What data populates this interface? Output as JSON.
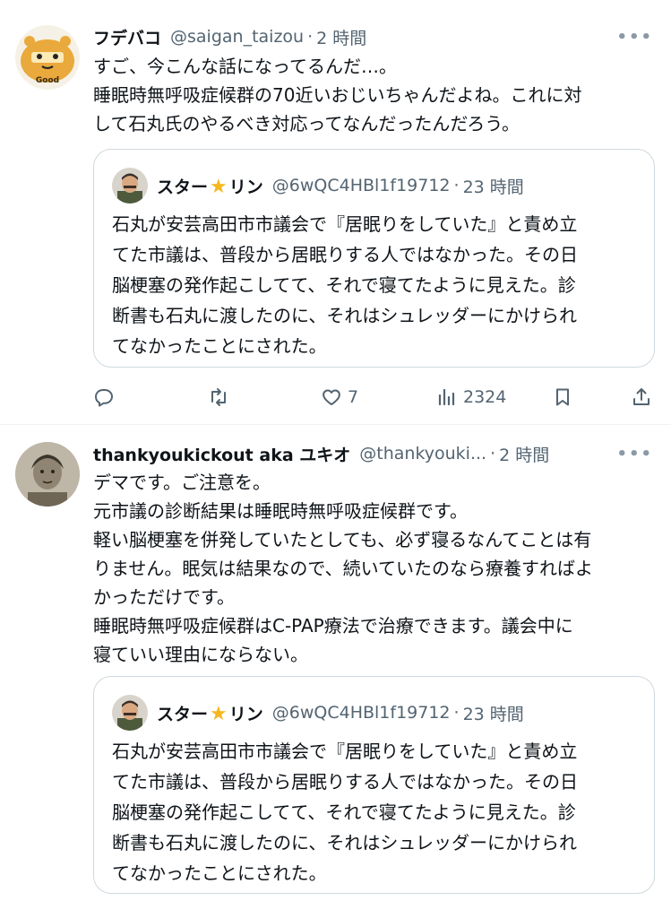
{
  "tweets": [
    {
      "display_name": "フデバコ",
      "handle": "@saigan_taizou",
      "time": "2 時間",
      "avatar_caption": "Good",
      "lines": [
        "すご、今こんな話になってるんだ…。",
        "睡眠時無呼吸症候群の70近いおじいちゃんだよね。これに対",
        "して石丸氏のやるべき対応ってなんだったんだろう。"
      ],
      "quote": {
        "name_before": "スター",
        "name_emoji": "★",
        "name_after": "リン",
        "handle": "@6wQC4HBl1f19712",
        "time": "23 時間",
        "lines": [
          "石丸が安芸高田市市議会で『居眠りをしていた』と責め立",
          "てた市議は、普段から居眠りする人ではなかった。その日",
          "脳梗塞の発作起こしてて、それで寝てたように見えた。診",
          "断書も石丸に渡したのに、それはシュレッダーにかけられ",
          "てなかったことにされた。"
        ]
      },
      "actions": {
        "likes": "7",
        "views": "2324"
      }
    },
    {
      "display_name": "thankyoukickout aka ユキオ",
      "handle": "@thankyouki...",
      "time": "2 時間",
      "lines": [
        "デマです。ご注意を。",
        "元市議の診断結果は睡眠時無呼吸症候群です。",
        "軽い脳梗塞を併発していたとしても、必ず寝るなんてことは有",
        "りません。眠気は結果なので、続いていたのなら療養すればよ",
        "かっただけです。",
        "睡眠時無呼吸症候群はC-PAP療法で治療できます。議会中に",
        "寝ていい理由にならない。"
      ],
      "quote": {
        "name_before": "スター",
        "name_emoji": "★",
        "name_after": "リン",
        "handle": "@6wQC4HBl1f19712",
        "time": "23 時間",
        "lines": [
          "石丸が安芸高田市市議会で『居眠りをしていた』と責め立",
          "てた市議は、普段から居眠りする人ではなかった。その日",
          "脳梗塞の発作起こしてて、それで寝てたように見えた。診",
          "断書も石丸に渡したのに、それはシュレッダーにかけられ",
          "てなかったことにされた。"
        ]
      }
    }
  ],
  "dot_separator": "·",
  "more_label": "•••",
  "icons": {
    "reply": "reply-icon",
    "retweet": "retweet-icon",
    "like": "heart-icon",
    "views": "views-icon",
    "bookmark": "bookmark-icon",
    "share": "share-icon",
    "more": "more-icon"
  },
  "colors": {
    "text": "#0f1419",
    "secondary": "#536471",
    "border": "#cfd9de",
    "divider": "#eff3f4",
    "star": "#f5b71d"
  }
}
